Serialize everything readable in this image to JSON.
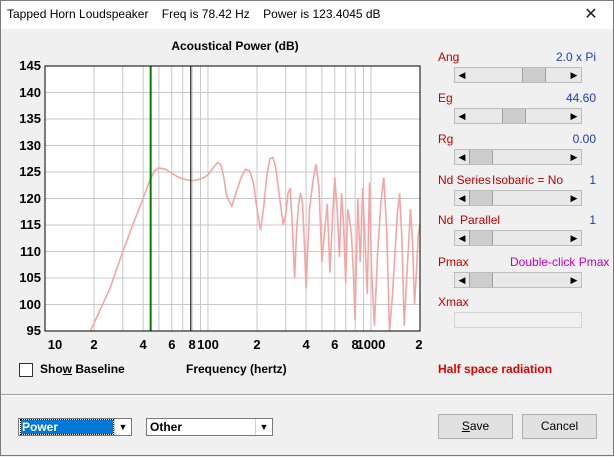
{
  "window": {
    "title": "Tapped Horn Loudspeaker    Freq is 78.42 Hz    Power is 123.4045 dB",
    "close_glyph": "✕"
  },
  "chart_data": {
    "type": "line",
    "title": "Acoustical Power (dB)",
    "xlabel": "Frequency (hertz)",
    "ylabel": "",
    "x_scale": "log",
    "xlim": [
      10,
      2000
    ],
    "ylim": [
      95,
      145
    ],
    "yticks": [
      95,
      100,
      105,
      110,
      115,
      120,
      125,
      130,
      135,
      140,
      145
    ],
    "xtick_labels": [
      "10",
      "2",
      "4",
      "6",
      "8",
      "100",
      "2",
      "4",
      "6",
      "8",
      "1000",
      "2"
    ],
    "xtick_values": [
      10,
      20,
      40,
      60,
      80,
      100,
      200,
      400,
      600,
      800,
      1000,
      2000
    ],
    "grid": true,
    "colors": {
      "curve": "#f4a6a6",
      "green_marker": "#008000",
      "black_marker": "#000000",
      "grid": "#c8c8c8"
    },
    "markers": {
      "green_x": 44.5,
      "black_x": 78.42
    },
    "series": [
      {
        "x": [
          19,
          25,
          30,
          35,
          40,
          44,
          47,
          50,
          55,
          60,
          65,
          70,
          75,
          80,
          85,
          90,
          95,
          100,
          105,
          110,
          115,
          120,
          125,
          130,
          140,
          150,
          160,
          170,
          180,
          190,
          200,
          210,
          220,
          230,
          240,
          250,
          260,
          270,
          280,
          290,
          300,
          310,
          320,
          330,
          340,
          350,
          360,
          370,
          380,
          390,
          400,
          420,
          440,
          460,
          480,
          500,
          520,
          540,
          560,
          580,
          600,
          620,
          640,
          660,
          680,
          700,
          720,
          740,
          760,
          780,
          800,
          830,
          860,
          890,
          920,
          950,
          980,
          1010,
          1050,
          1100,
          1150,
          1200,
          1250,
          1300,
          1350,
          1400,
          1450,
          1500,
          1550,
          1600,
          1650,
          1700,
          1750,
          1800,
          1850,
          1900,
          1950,
          2000
        ],
        "y": [
          95,
          103,
          110,
          115.5,
          120,
          123.5,
          125.2,
          125.8,
          125.5,
          124.8,
          124.1,
          123.7,
          123.5,
          123.4,
          123.5,
          123.7,
          124,
          124.5,
          125.3,
          126.2,
          126.8,
          126.4,
          124,
          120.5,
          118.5,
          121.5,
          124,
          125.5,
          125.2,
          123,
          118,
          114,
          118.5,
          124.5,
          127.5,
          127.8,
          126,
          122,
          118.5,
          115,
          117,
          121,
          122,
          114,
          105,
          114,
          119,
          121,
          119,
          112,
          103,
          118,
          123,
          126.5,
          122,
          108,
          114,
          119,
          106,
          116,
          124,
          118,
          109,
          121,
          115,
          104,
          118,
          116,
          113,
          106,
          97,
          120,
          108,
          122,
          112,
          102,
          123,
          106,
          96,
          110,
          119,
          124,
          114,
          95,
          101,
          109,
          117,
          121,
          112,
          96,
          104,
          111,
          118,
          112,
          100,
          106,
          113,
          115
        ]
      }
    ]
  },
  "controls": [
    {
      "label": "Ang",
      "value": "2.0 x Pi",
      "extra": "",
      "thumb_fraction": 0.72,
      "enabled": true
    },
    {
      "label": "Eg",
      "value": "44.60",
      "extra": "",
      "thumb_fraction": 0.45,
      "enabled": true
    },
    {
      "label": "Rg",
      "value": "0.00",
      "extra": "",
      "thumb_fraction": 0.0,
      "enabled": true
    },
    {
      "label": "Nd Series",
      "value": "1",
      "extra": "Isobaric = No",
      "thumb_fraction": 0.0,
      "enabled": true
    },
    {
      "label": "Nd  Parallel",
      "value": "1",
      "extra": "",
      "thumb_fraction": 0.0,
      "enabled": true
    },
    {
      "label": "Pmax",
      "value": "",
      "extra": "Double-click Pmax",
      "thumb_fraction": 0.0,
      "enabled": true
    },
    {
      "label": "Xmax",
      "value": "",
      "extra": "",
      "thumb_fraction": null,
      "enabled": false
    }
  ],
  "show_baseline": {
    "label_pre": "Sho",
    "label_accel": "w",
    "label_post": " Baseline",
    "checked": false
  },
  "half_space": "Half space radiation",
  "dropdowns": {
    "left": "Power",
    "right": "Other"
  },
  "buttons": {
    "save": "Save",
    "save_accel": "S",
    "cancel": "Cancel"
  }
}
